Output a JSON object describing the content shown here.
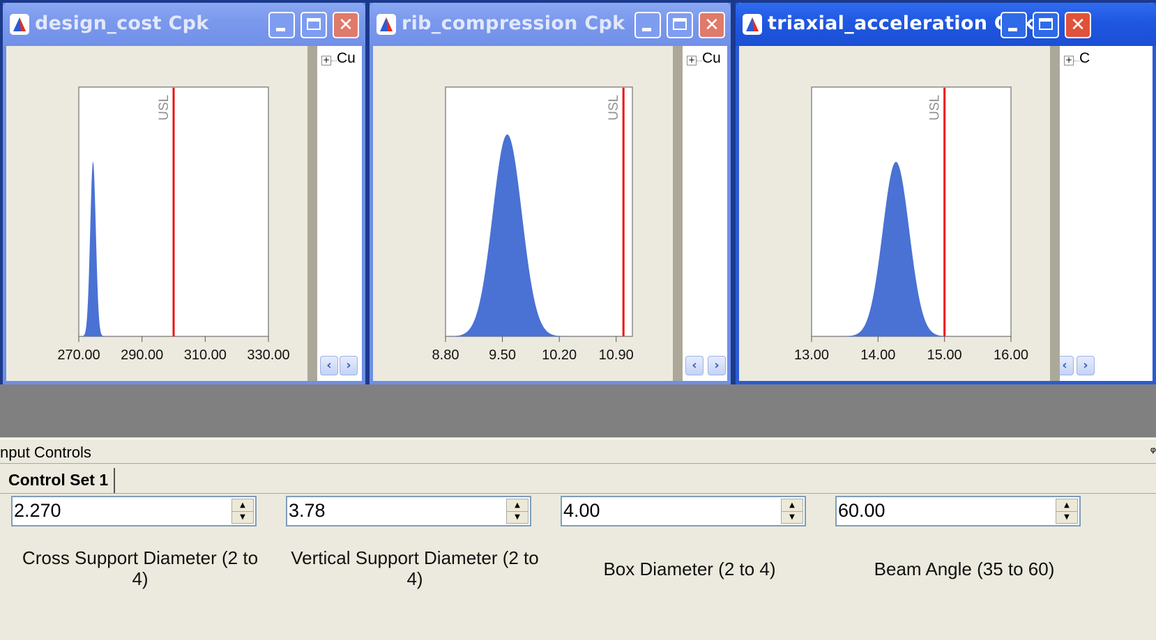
{
  "windows": [
    {
      "title": "design_cost Cpk",
      "tree_label": "Cu",
      "chart_data": {
        "type": "area",
        "title": "",
        "xlabel": "",
        "ylabel": "",
        "xlim": [
          270,
          330
        ],
        "x_ticks": [
          "270.00",
          "290.00",
          "310.00",
          "330.00"
        ],
        "tick_values": [
          270,
          290,
          310,
          330
        ],
        "usl": 300,
        "usl_label": "USL",
        "distribution": {
          "shape": "normal",
          "mean": 274.5,
          "sd": 0.9,
          "peak_fraction": 0.7
        },
        "grid": false
      }
    },
    {
      "title": "rib_compression Cpk",
      "tree_label": "Cu",
      "chart_data": {
        "type": "area",
        "title": "",
        "xlabel": "",
        "ylabel": "",
        "xlim": [
          8.8,
          11.1
        ],
        "x_ticks": [
          "8.80",
          "9.50",
          "10.20",
          "10.90"
        ],
        "tick_values": [
          8.8,
          9.5,
          10.2,
          10.9
        ],
        "usl": 10.99,
        "usl_label": "USL",
        "distribution": {
          "shape": "normal",
          "mean": 9.56,
          "sd": 0.18,
          "peak_fraction": 0.81
        },
        "grid": false
      }
    },
    {
      "title": "triaxial_acceleration Cpk",
      "tree_label": "C",
      "chart_data": {
        "type": "area",
        "title": "",
        "xlabel": "",
        "ylabel": "",
        "xlim": [
          13,
          16
        ],
        "x_ticks": [
          "13.00",
          "14.00",
          "15.00",
          "16.00"
        ],
        "tick_values": [
          13,
          14,
          15,
          16
        ],
        "usl": 15.0,
        "usl_label": "USL",
        "distribution": {
          "shape": "normal",
          "mean": 14.27,
          "sd": 0.2,
          "peak_fraction": 0.7
        },
        "grid": false
      }
    }
  ],
  "input_panel": {
    "title": "nput Controls",
    "tab_label": "Control Set 1",
    "controls": [
      {
        "value": "2.270",
        "label_line1": "Cross Support Diameter (2 to",
        "label_line2": "4)"
      },
      {
        "value": "3.78",
        "label_line1": "Vertical Support Diameter (2 to",
        "label_line2": "4)"
      },
      {
        "value": "4.00",
        "label_line1": "Box Diameter (2 to 4)",
        "label_line2": ""
      },
      {
        "value": "60.00",
        "label_line1": "Beam Angle (35 to 60)",
        "label_line2": ""
      }
    ]
  },
  "colors": {
    "fill": "#4a72d4",
    "usl": "#ee1111",
    "active_titlebar": "#1f57e0",
    "inactive_titlebar": "#7a98ec"
  }
}
